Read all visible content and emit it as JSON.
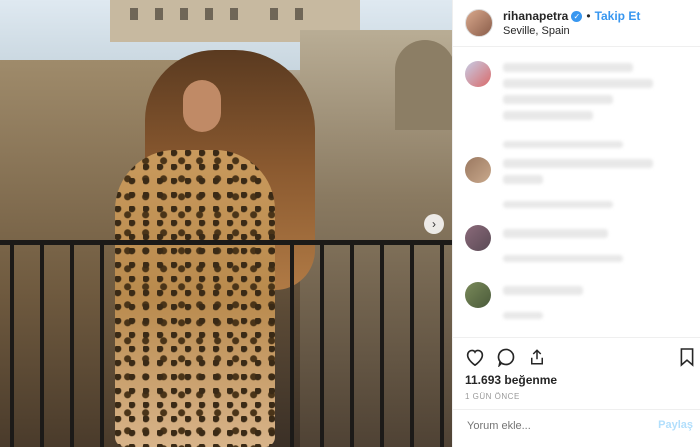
{
  "header": {
    "username": "rihanapetra",
    "verified_icon": "verified-check-icon",
    "separator": "•",
    "follow_label": "Takip Et",
    "location": "Seville, Spain"
  },
  "photo": {
    "next_icon": "chevron-right-icon"
  },
  "actions": {
    "like_icon": "heart-outline-icon",
    "comment_icon": "comment-bubble-icon",
    "share_icon": "share-upload-icon",
    "save_icon": "bookmark-outline-icon"
  },
  "likes_text": "11.693 beğenme",
  "timestamp": "1 GÜN ÖNCE",
  "comment_box": {
    "placeholder": "Yorum ekle...",
    "post_label": "Paylaş"
  },
  "colors": {
    "accent": "#3897f0",
    "post_disabled": "#b2dffc"
  }
}
